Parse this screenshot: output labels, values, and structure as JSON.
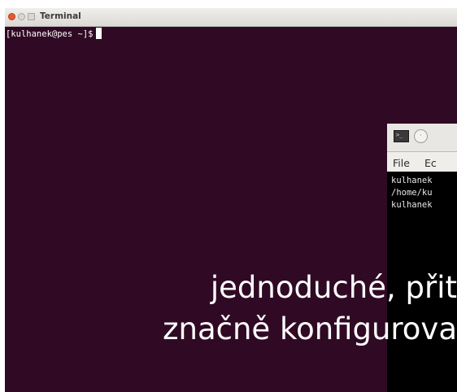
{
  "main_terminal": {
    "title": "Terminal",
    "prompt": "[kulhanek@pes ~]$"
  },
  "secondary_terminal": {
    "menu": [
      "File",
      "Ec"
    ],
    "lines": [
      "kulhanek",
      "/home/ku",
      "kulhanek"
    ]
  },
  "caption": {
    "line1": "jednoduché, přit",
    "line2": "značně konfigurova"
  },
  "colors": {
    "terminal_bg": "#300a24",
    "close_button": "#e9582f"
  },
  "icons": {
    "terminal_app": "terminal-icon",
    "window_menu": "window-menu-icon"
  }
}
